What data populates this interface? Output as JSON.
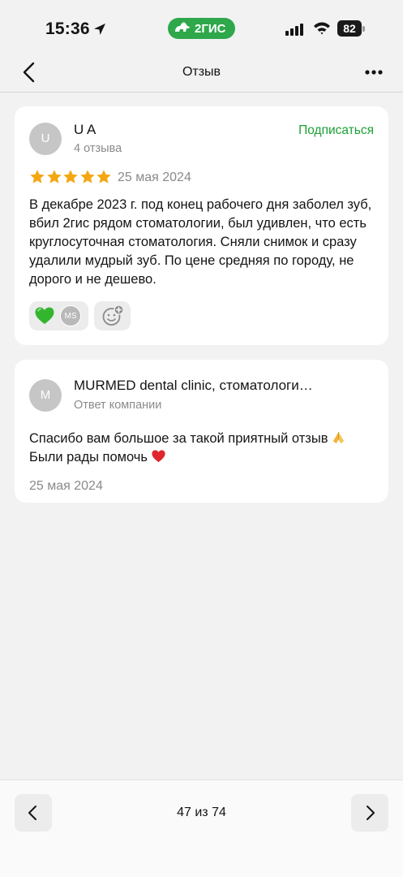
{
  "status_bar": {
    "time": "15:36",
    "brand_label": "2ГИС",
    "battery": "82"
  },
  "header": {
    "title": "Отзыв"
  },
  "review": {
    "avatar_letter": "U",
    "author": "U A",
    "author_meta": "4 отзыва",
    "subscribe_label": "Подписаться",
    "rating": 5,
    "date": "25 мая 2024",
    "text": "В декабре 2023 г. под конец рабочего дня заболел зуб, вбил 2гис рядом стоматологии, был удивлен, что есть круглосуточная стоматология. Сняли снимок и сразу удалили мудрый зуб. По цене средняя по городу, не дорого и не дешево.",
    "reactions": {
      "reactor_initials": "MS"
    }
  },
  "reply": {
    "avatar_letter": "M",
    "author": "MURMED dental clinic, стоматологи…",
    "author_meta": "Ответ компании",
    "line1": "Спасибо вам большое за такой приятный отзыв",
    "line2": "Были рады помочь",
    "date": "25 мая 2024"
  },
  "pager": {
    "label": "47 из 74"
  },
  "colors": {
    "accent_green": "#1ba136",
    "brand_green": "#2ea84a",
    "star_gold": "#f3a712",
    "muted_text": "#8a8a8a"
  }
}
